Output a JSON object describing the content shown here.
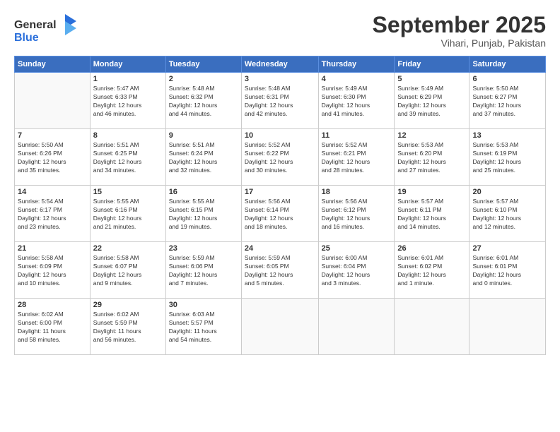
{
  "logo": {
    "general": "General",
    "blue": "Blue"
  },
  "title": "September 2025",
  "subtitle": "Vihari, Punjab, Pakistan",
  "weekdays": [
    "Sunday",
    "Monday",
    "Tuesday",
    "Wednesday",
    "Thursday",
    "Friday",
    "Saturday"
  ],
  "weeks": [
    [
      {
        "day": "",
        "info": ""
      },
      {
        "day": "1",
        "info": "Sunrise: 5:47 AM\nSunset: 6:33 PM\nDaylight: 12 hours\nand 46 minutes."
      },
      {
        "day": "2",
        "info": "Sunrise: 5:48 AM\nSunset: 6:32 PM\nDaylight: 12 hours\nand 44 minutes."
      },
      {
        "day": "3",
        "info": "Sunrise: 5:48 AM\nSunset: 6:31 PM\nDaylight: 12 hours\nand 42 minutes."
      },
      {
        "day": "4",
        "info": "Sunrise: 5:49 AM\nSunset: 6:30 PM\nDaylight: 12 hours\nand 41 minutes."
      },
      {
        "day": "5",
        "info": "Sunrise: 5:49 AM\nSunset: 6:29 PM\nDaylight: 12 hours\nand 39 minutes."
      },
      {
        "day": "6",
        "info": "Sunrise: 5:50 AM\nSunset: 6:27 PM\nDaylight: 12 hours\nand 37 minutes."
      }
    ],
    [
      {
        "day": "7",
        "info": "Sunrise: 5:50 AM\nSunset: 6:26 PM\nDaylight: 12 hours\nand 35 minutes."
      },
      {
        "day": "8",
        "info": "Sunrise: 5:51 AM\nSunset: 6:25 PM\nDaylight: 12 hours\nand 34 minutes."
      },
      {
        "day": "9",
        "info": "Sunrise: 5:51 AM\nSunset: 6:24 PM\nDaylight: 12 hours\nand 32 minutes."
      },
      {
        "day": "10",
        "info": "Sunrise: 5:52 AM\nSunset: 6:22 PM\nDaylight: 12 hours\nand 30 minutes."
      },
      {
        "day": "11",
        "info": "Sunrise: 5:52 AM\nSunset: 6:21 PM\nDaylight: 12 hours\nand 28 minutes."
      },
      {
        "day": "12",
        "info": "Sunrise: 5:53 AM\nSunset: 6:20 PM\nDaylight: 12 hours\nand 27 minutes."
      },
      {
        "day": "13",
        "info": "Sunrise: 5:53 AM\nSunset: 6:19 PM\nDaylight: 12 hours\nand 25 minutes."
      }
    ],
    [
      {
        "day": "14",
        "info": "Sunrise: 5:54 AM\nSunset: 6:17 PM\nDaylight: 12 hours\nand 23 minutes."
      },
      {
        "day": "15",
        "info": "Sunrise: 5:55 AM\nSunset: 6:16 PM\nDaylight: 12 hours\nand 21 minutes."
      },
      {
        "day": "16",
        "info": "Sunrise: 5:55 AM\nSunset: 6:15 PM\nDaylight: 12 hours\nand 19 minutes."
      },
      {
        "day": "17",
        "info": "Sunrise: 5:56 AM\nSunset: 6:14 PM\nDaylight: 12 hours\nand 18 minutes."
      },
      {
        "day": "18",
        "info": "Sunrise: 5:56 AM\nSunset: 6:12 PM\nDaylight: 12 hours\nand 16 minutes."
      },
      {
        "day": "19",
        "info": "Sunrise: 5:57 AM\nSunset: 6:11 PM\nDaylight: 12 hours\nand 14 minutes."
      },
      {
        "day": "20",
        "info": "Sunrise: 5:57 AM\nSunset: 6:10 PM\nDaylight: 12 hours\nand 12 minutes."
      }
    ],
    [
      {
        "day": "21",
        "info": "Sunrise: 5:58 AM\nSunset: 6:09 PM\nDaylight: 12 hours\nand 10 minutes."
      },
      {
        "day": "22",
        "info": "Sunrise: 5:58 AM\nSunset: 6:07 PM\nDaylight: 12 hours\nand 9 minutes."
      },
      {
        "day": "23",
        "info": "Sunrise: 5:59 AM\nSunset: 6:06 PM\nDaylight: 12 hours\nand 7 minutes."
      },
      {
        "day": "24",
        "info": "Sunrise: 5:59 AM\nSunset: 6:05 PM\nDaylight: 12 hours\nand 5 minutes."
      },
      {
        "day": "25",
        "info": "Sunrise: 6:00 AM\nSunset: 6:04 PM\nDaylight: 12 hours\nand 3 minutes."
      },
      {
        "day": "26",
        "info": "Sunrise: 6:01 AM\nSunset: 6:02 PM\nDaylight: 12 hours\nand 1 minute."
      },
      {
        "day": "27",
        "info": "Sunrise: 6:01 AM\nSunset: 6:01 PM\nDaylight: 12 hours\nand 0 minutes."
      }
    ],
    [
      {
        "day": "28",
        "info": "Sunrise: 6:02 AM\nSunset: 6:00 PM\nDaylight: 11 hours\nand 58 minutes."
      },
      {
        "day": "29",
        "info": "Sunrise: 6:02 AM\nSunset: 5:59 PM\nDaylight: 11 hours\nand 56 minutes."
      },
      {
        "day": "30",
        "info": "Sunrise: 6:03 AM\nSunset: 5:57 PM\nDaylight: 11 hours\nand 54 minutes."
      },
      {
        "day": "",
        "info": ""
      },
      {
        "day": "",
        "info": ""
      },
      {
        "day": "",
        "info": ""
      },
      {
        "day": "",
        "info": ""
      }
    ]
  ]
}
